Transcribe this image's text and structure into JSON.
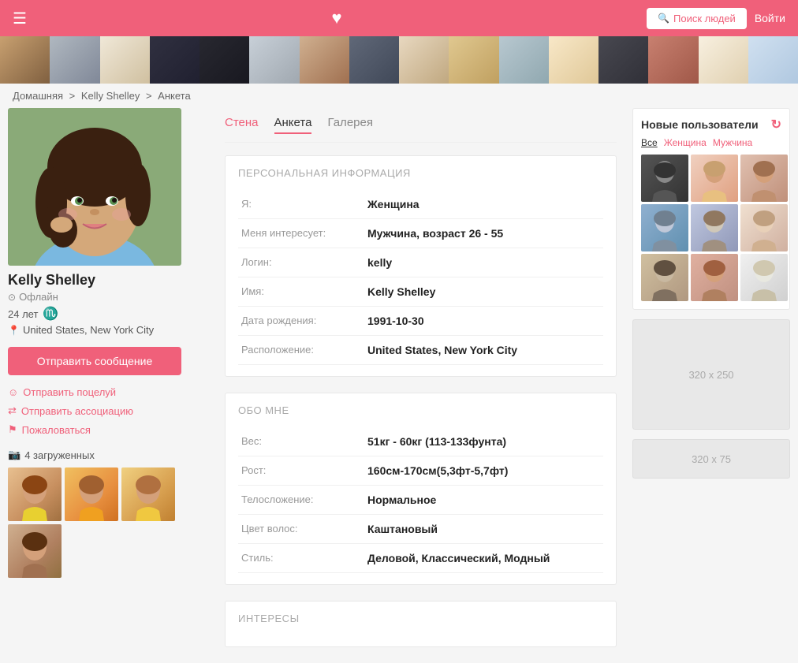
{
  "header": {
    "menu_icon": "☰",
    "heart_icon": "♥",
    "search_button": "Поиск людей",
    "login_button": "Войти"
  },
  "breadcrumb": {
    "home": "Домашняя",
    "separator": ">",
    "name": "Kelly Shelley",
    "page": "Анкета"
  },
  "profile": {
    "name": "Kelly Shelley",
    "status": "Офлайн",
    "age": "24 лет",
    "zodiac": "♏",
    "location": "United States, New York City",
    "message_button": "Отправить сообщение",
    "actions": {
      "kiss": "Отправить поцелуй",
      "association": "Отправить ассоциацию",
      "report": "Пожаловаться"
    },
    "photos_count": "4 загруженных"
  },
  "tabs": {
    "wall": "Стена",
    "profile": "Анкета",
    "gallery": "Галерея"
  },
  "personal_info": {
    "section_title": "ПЕРСОНАЛЬНАЯ ИНФОРМАЦИЯ",
    "fields": [
      {
        "label": "Я:",
        "value": "Женщина"
      },
      {
        "label": "Меня интересует:",
        "value": "Мужчина, возраст 26 - 55"
      },
      {
        "label": "Логин:",
        "value": "kelly"
      },
      {
        "label": "Имя:",
        "value": "Kelly Shelley"
      },
      {
        "label": "Дата рождения:",
        "value": "1991-10-30"
      },
      {
        "label": "Расположение:",
        "value": "United States, New York City"
      }
    ]
  },
  "about_me": {
    "section_title": "ОБО МНЕ",
    "fields": [
      {
        "label": "Вес:",
        "value": "51кг - 60кг (113-133фунта)"
      },
      {
        "label": "Рост:",
        "value": "160см-170см(5,3фт-5,7фт)"
      },
      {
        "label": "Телосложение:",
        "value": "Нормальное"
      },
      {
        "label": "Цвет волос:",
        "value": "Каштановый"
      },
      {
        "label": "Стиль:",
        "value": "Деловой, Классический, Модный"
      }
    ]
  },
  "interests": {
    "section_title": "ИНТЕРЕСЫ"
  },
  "new_users": {
    "title": "Новые пользователи",
    "filters": [
      "Все",
      "Женщина",
      "Мужчина"
    ]
  },
  "ads": {
    "large": "320 x 250",
    "small": "320 x 75"
  }
}
